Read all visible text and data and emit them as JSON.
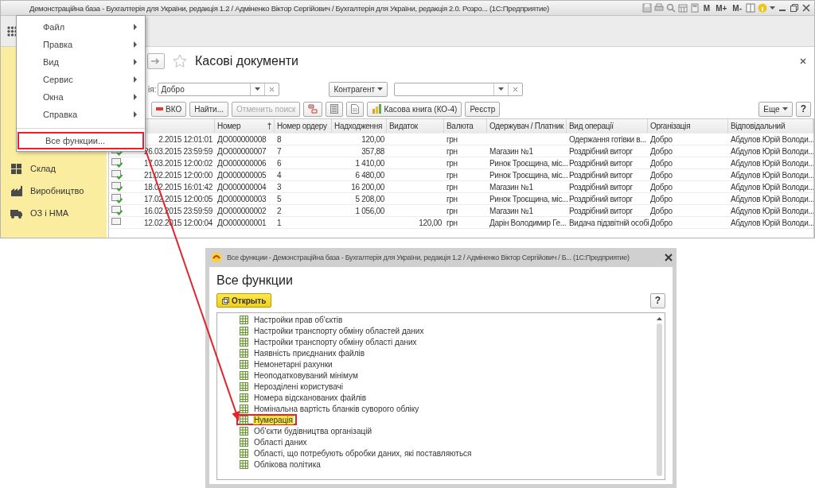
{
  "window": {
    "title": "Демонстраційна база - Бухгалтерія для України, редакція 1.2 / Адміненко Віктор Сергійович / Бухгалтерія для України, редакція 2.0. Розро...  (1С:Предприятие)",
    "memory_buttons": [
      "M",
      "M+",
      "M-"
    ]
  },
  "main_menu": {
    "items": [
      {
        "label": "Файл",
        "submenu": true,
        "annotated": false
      },
      {
        "label": "Правка",
        "submenu": true,
        "annotated": false
      },
      {
        "label": "Вид",
        "submenu": true,
        "annotated": false
      },
      {
        "label": "Сервис",
        "submenu": true,
        "annotated": false
      },
      {
        "label": "Окна",
        "submenu": true,
        "annotated": false
      },
      {
        "label": "Справка",
        "submenu": true,
        "annotated": false
      },
      {
        "label": "Все функции...",
        "submenu": false,
        "annotated": true
      }
    ]
  },
  "sidebar": {
    "items": [
      {
        "label": "Склад"
      },
      {
        "label": "Виробництво"
      },
      {
        "label": "ОЗ і НМА"
      }
    ]
  },
  "form": {
    "title": "Касові документи",
    "filter": {
      "label": "ія:",
      "value": "Добро"
    },
    "counterparty_button": "Контрагент",
    "toolbar": [
      {
        "kind": "expense",
        "label": "ВКО",
        "disabled": false
      },
      {
        "kind": "text",
        "label": "Найти...",
        "disabled": false
      },
      {
        "kind": "text",
        "label": "Отменить поиск",
        "disabled": true
      },
      {
        "kind": "dtkt",
        "disabled": false
      },
      {
        "kind": "list",
        "disabled": false
      },
      {
        "kind": "report",
        "disabled": false
      },
      {
        "kind": "book",
        "label": "Касова книга (КО-4)",
        "disabled": false
      },
      {
        "kind": "text",
        "label": "Реєстр",
        "disabled": false
      }
    ],
    "more_button": "Еще",
    "help_button": "?"
  },
  "table": {
    "columns": [
      {
        "label": "Номер",
        "sorted": true
      },
      {
        "label": "Номер ордеру",
        "sorted": false
      },
      {
        "label": "Надходження",
        "sorted": false
      },
      {
        "label": "Видаток",
        "sorted": false
      },
      {
        "label": "Валюта",
        "sorted": false
      },
      {
        "label": "Одержувач / Платник",
        "sorted": false
      },
      {
        "label": "Вид операції",
        "sorted": false
      },
      {
        "label": "Організація",
        "sorted": false
      },
      {
        "label": "Відповідальний",
        "sorted": false
      }
    ],
    "rows": [
      {
        "date": "2.2015 12:01:01",
        "number": "ДО000000008",
        "order": "8",
        "income": "120,00",
        "currency": "грн",
        "operation": "Одержання готівки в...",
        "organization": "Добро",
        "responsible": "Абдулов Юрій Володи..."
      },
      {
        "posted": true,
        "date": "26.03.2015 23:59:59",
        "number": "ДО000000007",
        "order": "7",
        "income": "357,88",
        "currency": "грн",
        "counterparty": "Магазин №1",
        "operation": "Роздрібний виторг",
        "organization": "Добро",
        "responsible": "Абдулов Юрій Володи..."
      },
      {
        "posted": true,
        "date": "17.03.2015 12:00:02",
        "number": "ДО000000006",
        "order": "6",
        "income": "1 410,00",
        "currency": "грн",
        "counterparty": "Ринок Троєщина, міс...",
        "operation": "Роздрібний виторг",
        "organization": "Добро",
        "responsible": "Абдулов Юрій Володи..."
      },
      {
        "posted": true,
        "date": "21.02.2015 12:00:00",
        "number": "ДО000000005",
        "order": "4",
        "income": "6 480,00",
        "currency": "грн",
        "counterparty": "Ринок Троєщина, міс...",
        "operation": "Роздрібний виторг",
        "organization": "Добро",
        "responsible": "Абдулов Юрій Володи..."
      },
      {
        "posted": true,
        "date": "18.02.2015 16:01:42",
        "number": "ДО000000004",
        "order": "3",
        "income": "16 200,00",
        "currency": "грн",
        "counterparty": "Магазин №1",
        "operation": "Роздрібний виторг",
        "organization": "Добро",
        "responsible": "Абдулов Юрій Володи..."
      },
      {
        "posted": true,
        "date": "17.02.2015 12:00:05",
        "number": "ДО000000003",
        "order": "5",
        "income": "5 208,00",
        "currency": "грн",
        "counterparty": "Ринок Троєщина, міс...",
        "operation": "Роздрібний виторг",
        "organization": "Добро",
        "responsible": "Абдулов Юрій Володи..."
      },
      {
        "posted": true,
        "date": "16.02.2015 23:59:59",
        "number": "ДО000000002",
        "order": "2",
        "income": "1 056,00",
        "currency": "грн",
        "counterparty": "Магазин №1",
        "operation": "Роздрібний виторг",
        "organization": "Добро",
        "responsible": "Абдулов Юрій Володи..."
      },
      {
        "posted": false,
        "date": "12.02.2015 12:00:04",
        "number": "ДО000000001",
        "order": "1",
        "expense": "120,00",
        "currency": "грн",
        "counterparty": "Дарін Володимир Ге...",
        "operation": "Видача підзвітній особі",
        "organization": "Добро",
        "responsible": "Абдулов Юрій Володи..."
      }
    ]
  },
  "dialog": {
    "title": "Все функции - Демонстраційна база - Бухгалтерія для України, редакція 1.2 / Адміненко Віктор Сергійович / Б...   (1С:Предприятие)",
    "heading": "Все функции",
    "open_button": "Открыть",
    "help_button": "?",
    "items": [
      {
        "label": "Настройки прав об'єктів",
        "selected": false,
        "annotated": false
      },
      {
        "label": "Настройки транспорту обміну областей даних",
        "selected": false,
        "annotated": false
      },
      {
        "label": "Настройки транспорту обміну області даних",
        "selected": false,
        "annotated": false
      },
      {
        "label": "Наявність приєднаних файлів",
        "selected": false,
        "annotated": false
      },
      {
        "label": "Немонетарні рахунки",
        "selected": false,
        "annotated": false
      },
      {
        "label": "Неоподатковуваний мінімум",
        "selected": false,
        "annotated": false
      },
      {
        "label": "Нерозділені користувачі",
        "selected": false,
        "annotated": false
      },
      {
        "label": "Номера відсканованих файлів",
        "selected": false,
        "annotated": false
      },
      {
        "label": "Номінальна вартість бланків суворого обліку",
        "selected": false,
        "annotated": false
      },
      {
        "label": "Нумерація",
        "selected": true,
        "annotated": true
      },
      {
        "label": "Об'єкти будівництва організацій",
        "selected": false,
        "annotated": false
      },
      {
        "label": "Області даних",
        "selected": false,
        "annotated": false
      },
      {
        "label": "Області, що потребують обробки даних, які поставляються",
        "selected": false,
        "annotated": false
      },
      {
        "label": "Облікова політика",
        "selected": false,
        "annotated": false
      }
    ]
  }
}
